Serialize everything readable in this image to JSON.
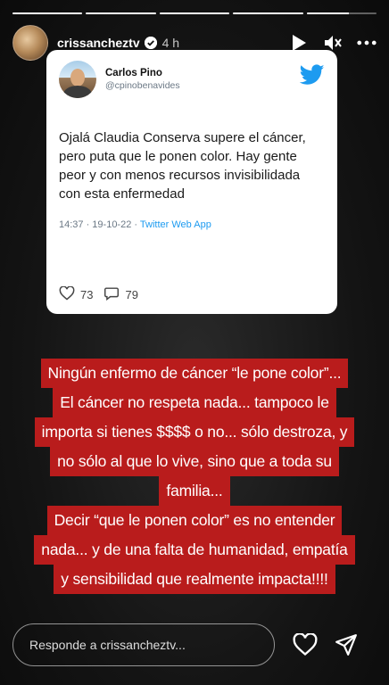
{
  "story": {
    "progress_segments": [
      1,
      1,
      1,
      1,
      0.6
    ],
    "user": {
      "username": "crissancheztv",
      "time_ago": "4 h"
    }
  },
  "tweet": {
    "author_name": "Carlos Pino",
    "author_handle": "@cpinobenavides",
    "text": "Ojalá Claudia Conserva supere el cáncer, pero puta que le ponen color. Hay gente peor y con menos recursos invisibilidada con esta enfermedad",
    "timestamp": "14:37 · 19-10-22 · ",
    "source": "Twitter Web App",
    "likes": "73",
    "replies": "79",
    "brand_color": "#1d9bf0"
  },
  "caption": {
    "lines": [
      "Ningún enfermo de cáncer “le pone color”...",
      "El cáncer no respeta nada... tampoco le",
      "importa si tienes $$$$ o no... sólo destroza, y",
      "no sólo al que lo vive, sino que a toda su",
      "familia...",
      "Decir “que le ponen color” es no entender",
      "nada... y de una falta de humanidad, empatía",
      "y sensibilidad que realmente impacta!!!!"
    ],
    "highlight_color": "#b91c1c"
  },
  "footer": {
    "reply_placeholder": "Responde a crissancheztv..."
  },
  "icons": {
    "header": [
      "play-icon",
      "mute-icon",
      "more-icon"
    ],
    "footer": [
      "heart-icon",
      "send-icon"
    ]
  }
}
